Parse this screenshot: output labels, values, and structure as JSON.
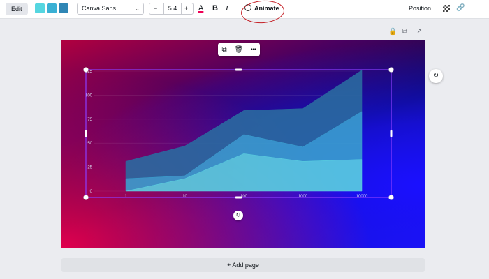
{
  "toolbar": {
    "edit_label": "Edit",
    "swatches": [
      "#55d6e0",
      "#3ab0d4",
      "#2f86b5"
    ],
    "font_name": "Canva Sans",
    "font_size": "5.4",
    "minus_label": "−",
    "plus_label": "+",
    "color_glyph": "A",
    "bold_glyph": "B",
    "italic_glyph": "I",
    "animate_label": "Animate",
    "position_label": "Position"
  },
  "floating_toolbar": {
    "more_glyph": "•••"
  },
  "chart_data": {
    "type": "area",
    "x_scale": "log",
    "x": [
      1,
      10,
      100,
      1000,
      10000
    ],
    "x_tick_labels": [
      "1",
      "10",
      "100",
      "1000",
      "10000"
    ],
    "y_ticks": [
      0,
      25,
      50,
      75,
      100,
      125
    ],
    "y_tick_labels": [
      "0",
      "25",
      "50",
      "75",
      "100",
      "125"
    ],
    "ylim": [
      0,
      125
    ],
    "stacked": true,
    "series": [
      {
        "values": [
          0,
          13,
          39,
          31,
          33
        ],
        "color": "#5ad0e0"
      },
      {
        "values": [
          13,
          3,
          20,
          15,
          50
        ],
        "color": "#3a9fce"
      },
      {
        "values": [
          18,
          31,
          25,
          40,
          43
        ],
        "color": "#2a6aa0"
      }
    ],
    "grid": true
  },
  "bottom": {
    "add_page_label": "+ Add page"
  }
}
